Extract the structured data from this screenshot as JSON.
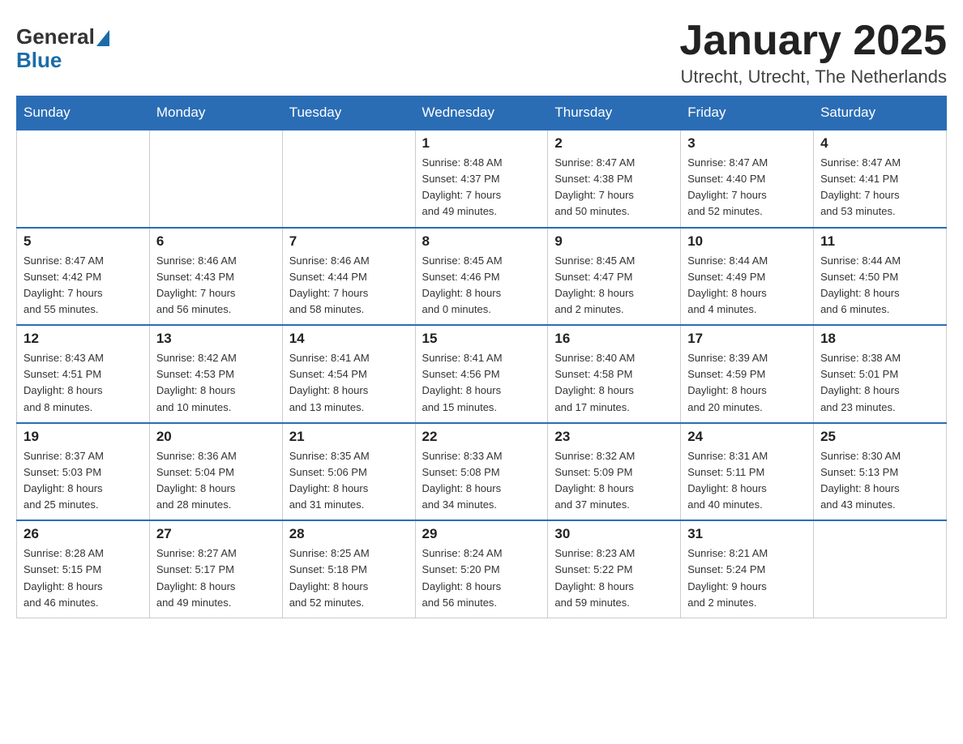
{
  "header": {
    "title": "January 2025",
    "location": "Utrecht, Utrecht, The Netherlands",
    "logo_general": "General",
    "logo_blue": "Blue"
  },
  "days_of_week": [
    "Sunday",
    "Monday",
    "Tuesday",
    "Wednesday",
    "Thursday",
    "Friday",
    "Saturday"
  ],
  "weeks": [
    [
      {
        "day": "",
        "info": ""
      },
      {
        "day": "",
        "info": ""
      },
      {
        "day": "",
        "info": ""
      },
      {
        "day": "1",
        "info": "Sunrise: 8:48 AM\nSunset: 4:37 PM\nDaylight: 7 hours\nand 49 minutes."
      },
      {
        "day": "2",
        "info": "Sunrise: 8:47 AM\nSunset: 4:38 PM\nDaylight: 7 hours\nand 50 minutes."
      },
      {
        "day": "3",
        "info": "Sunrise: 8:47 AM\nSunset: 4:40 PM\nDaylight: 7 hours\nand 52 minutes."
      },
      {
        "day": "4",
        "info": "Sunrise: 8:47 AM\nSunset: 4:41 PM\nDaylight: 7 hours\nand 53 minutes."
      }
    ],
    [
      {
        "day": "5",
        "info": "Sunrise: 8:47 AM\nSunset: 4:42 PM\nDaylight: 7 hours\nand 55 minutes."
      },
      {
        "day": "6",
        "info": "Sunrise: 8:46 AM\nSunset: 4:43 PM\nDaylight: 7 hours\nand 56 minutes."
      },
      {
        "day": "7",
        "info": "Sunrise: 8:46 AM\nSunset: 4:44 PM\nDaylight: 7 hours\nand 58 minutes."
      },
      {
        "day": "8",
        "info": "Sunrise: 8:45 AM\nSunset: 4:46 PM\nDaylight: 8 hours\nand 0 minutes."
      },
      {
        "day": "9",
        "info": "Sunrise: 8:45 AM\nSunset: 4:47 PM\nDaylight: 8 hours\nand 2 minutes."
      },
      {
        "day": "10",
        "info": "Sunrise: 8:44 AM\nSunset: 4:49 PM\nDaylight: 8 hours\nand 4 minutes."
      },
      {
        "day": "11",
        "info": "Sunrise: 8:44 AM\nSunset: 4:50 PM\nDaylight: 8 hours\nand 6 minutes."
      }
    ],
    [
      {
        "day": "12",
        "info": "Sunrise: 8:43 AM\nSunset: 4:51 PM\nDaylight: 8 hours\nand 8 minutes."
      },
      {
        "day": "13",
        "info": "Sunrise: 8:42 AM\nSunset: 4:53 PM\nDaylight: 8 hours\nand 10 minutes."
      },
      {
        "day": "14",
        "info": "Sunrise: 8:41 AM\nSunset: 4:54 PM\nDaylight: 8 hours\nand 13 minutes."
      },
      {
        "day": "15",
        "info": "Sunrise: 8:41 AM\nSunset: 4:56 PM\nDaylight: 8 hours\nand 15 minutes."
      },
      {
        "day": "16",
        "info": "Sunrise: 8:40 AM\nSunset: 4:58 PM\nDaylight: 8 hours\nand 17 minutes."
      },
      {
        "day": "17",
        "info": "Sunrise: 8:39 AM\nSunset: 4:59 PM\nDaylight: 8 hours\nand 20 minutes."
      },
      {
        "day": "18",
        "info": "Sunrise: 8:38 AM\nSunset: 5:01 PM\nDaylight: 8 hours\nand 23 minutes."
      }
    ],
    [
      {
        "day": "19",
        "info": "Sunrise: 8:37 AM\nSunset: 5:03 PM\nDaylight: 8 hours\nand 25 minutes."
      },
      {
        "day": "20",
        "info": "Sunrise: 8:36 AM\nSunset: 5:04 PM\nDaylight: 8 hours\nand 28 minutes."
      },
      {
        "day": "21",
        "info": "Sunrise: 8:35 AM\nSunset: 5:06 PM\nDaylight: 8 hours\nand 31 minutes."
      },
      {
        "day": "22",
        "info": "Sunrise: 8:33 AM\nSunset: 5:08 PM\nDaylight: 8 hours\nand 34 minutes."
      },
      {
        "day": "23",
        "info": "Sunrise: 8:32 AM\nSunset: 5:09 PM\nDaylight: 8 hours\nand 37 minutes."
      },
      {
        "day": "24",
        "info": "Sunrise: 8:31 AM\nSunset: 5:11 PM\nDaylight: 8 hours\nand 40 minutes."
      },
      {
        "day": "25",
        "info": "Sunrise: 8:30 AM\nSunset: 5:13 PM\nDaylight: 8 hours\nand 43 minutes."
      }
    ],
    [
      {
        "day": "26",
        "info": "Sunrise: 8:28 AM\nSunset: 5:15 PM\nDaylight: 8 hours\nand 46 minutes."
      },
      {
        "day": "27",
        "info": "Sunrise: 8:27 AM\nSunset: 5:17 PM\nDaylight: 8 hours\nand 49 minutes."
      },
      {
        "day": "28",
        "info": "Sunrise: 8:25 AM\nSunset: 5:18 PM\nDaylight: 8 hours\nand 52 minutes."
      },
      {
        "day": "29",
        "info": "Sunrise: 8:24 AM\nSunset: 5:20 PM\nDaylight: 8 hours\nand 56 minutes."
      },
      {
        "day": "30",
        "info": "Sunrise: 8:23 AM\nSunset: 5:22 PM\nDaylight: 8 hours\nand 59 minutes."
      },
      {
        "day": "31",
        "info": "Sunrise: 8:21 AM\nSunset: 5:24 PM\nDaylight: 9 hours\nand 2 minutes."
      },
      {
        "day": "",
        "info": ""
      }
    ]
  ]
}
